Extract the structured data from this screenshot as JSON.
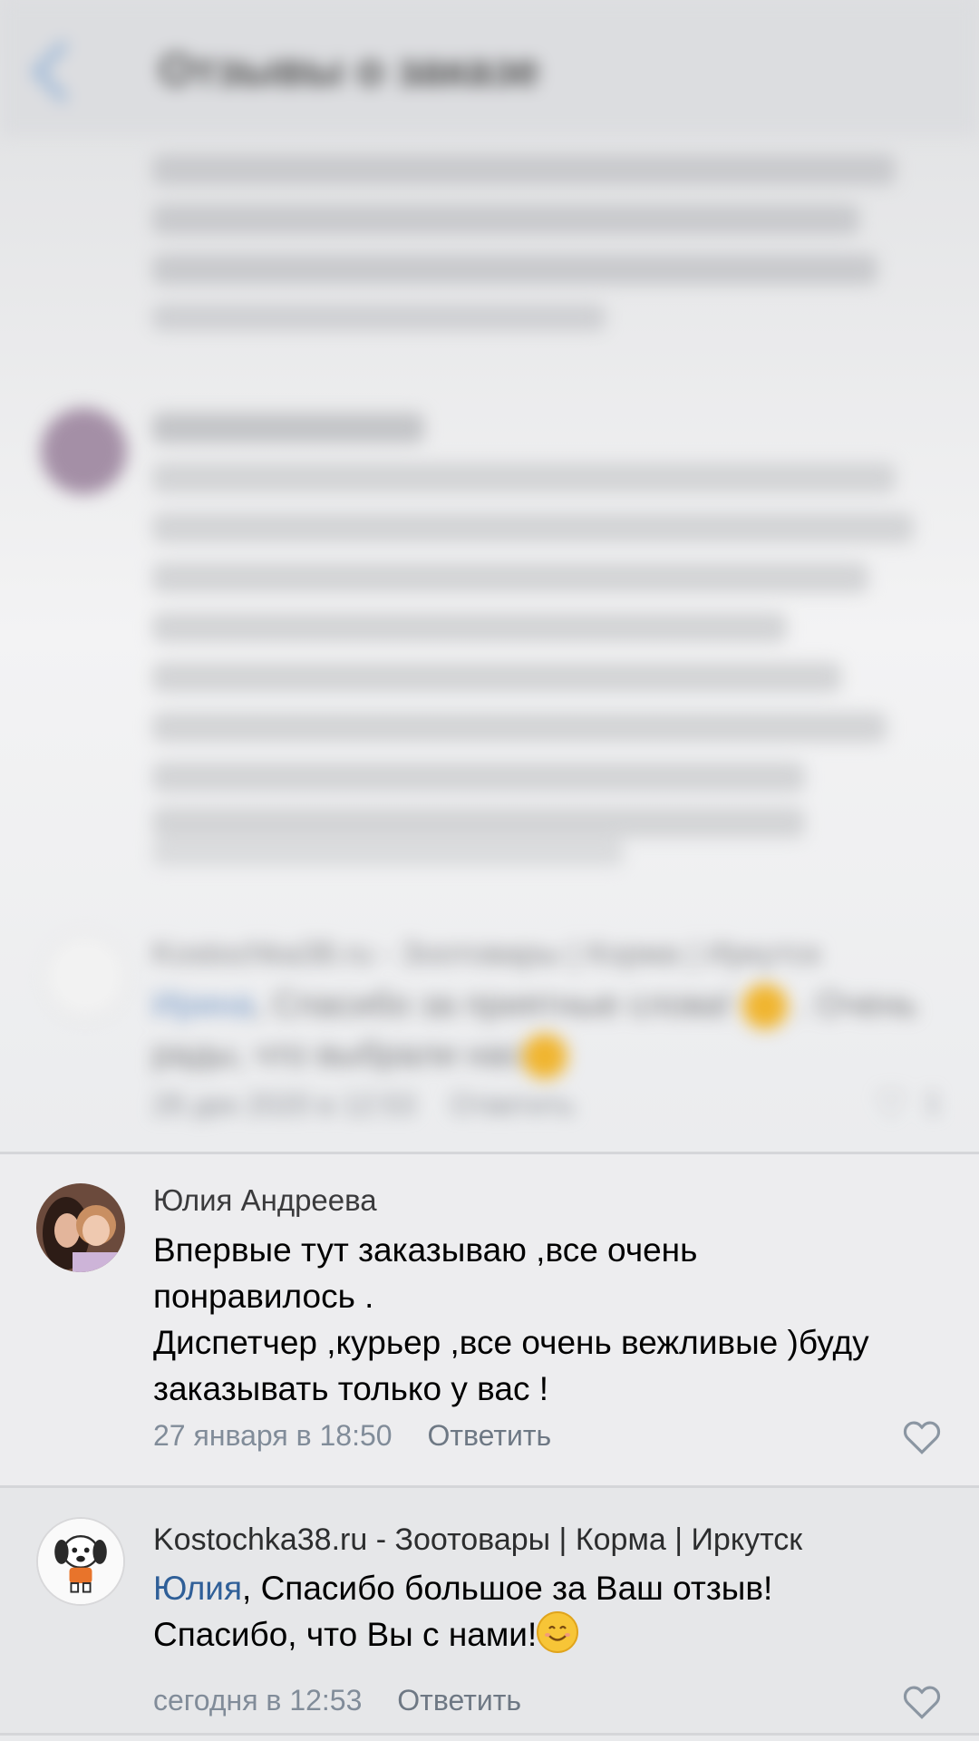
{
  "blurred": {
    "title": "Отзывы о заказе",
    "comment_a_author": "Костиочка38 - Зоотовары",
    "comment_b_author": "Kostochka38.ru - Зоотовары | Корма | Иркутск",
    "comment_b_mention": "Ирина",
    "comment_b_text1": ", Спасибо за приятные слова!",
    "comment_b_text1_end": ". Очень",
    "comment_b_text2": "рады, что выбрали нас",
    "comment_b_date": "28 дек 2020 в 12:53",
    "comment_b_reply": "Ответить",
    "comment_b_likes": "1"
  },
  "comments": [
    {
      "author": "Юлия Андреева",
      "lines": [
        "Впервые тут заказываю ,все очень",
        "понравилось .",
        "Диспетчер ,курьер ,все очень вежливые )буду",
        "заказывать только у вас !"
      ],
      "date": "27 января в 18:50",
      "reply": "Ответить"
    },
    {
      "author": "Kostochka38.ru - Зоотовары | Корма | Иркутск",
      "mention": "Юлия",
      "line1_rest": ", Спасибо большое за Ваш отзыв!",
      "line2": "Спасибо, что Вы с нами!",
      "date": "сегодня в 12:53",
      "reply": "Ответить"
    }
  ],
  "colors": {
    "mention": "#2f5f98",
    "meta": "#818c99"
  }
}
